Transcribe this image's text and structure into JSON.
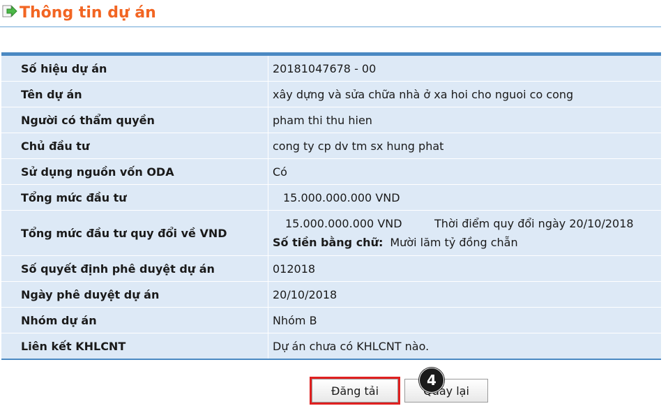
{
  "header": {
    "title": "Thông tin dự án",
    "icon": "export-arrow-icon",
    "title_color": "#f26522"
  },
  "rows": [
    {
      "label": "Số hiệu dự án",
      "value": "20181047678  -  00"
    },
    {
      "label": "Tên dự án",
      "value": "xây dựng và sửa chữa nhà ở xa hoi cho nguoi co cong"
    },
    {
      "label": "Người có thẩm quyền",
      "value": "pham thi thu hien"
    },
    {
      "label": "Chủ đầu tư",
      "value": "cong ty cp dv tm sx hung phat"
    },
    {
      "label": "Sử dụng nguồn vốn ODA",
      "value": "Có"
    },
    {
      "label": "Tổng mức đầu tư",
      "value": "15.000.000.000 VND"
    },
    {
      "label": "Tổng mức đầu tư quy đổi về VND",
      "amount": "15.000.000.000 VND",
      "conversion_note": "Thời điểm quy đổi ngày 20/10/2018",
      "words_label": "Số tiền bằng chữ:",
      "words_value": "Mười lăm tỷ đồng chẵn"
    },
    {
      "label": "Số quyết định phê duyệt dự án",
      "value": "012018"
    },
    {
      "label": "Ngày phê duyệt dự án",
      "value": "20/10/2018"
    },
    {
      "label": "Nhóm dự án",
      "value": "Nhóm B"
    },
    {
      "label": "Liên kết KHLCNT",
      "value": "Dự án chưa có KHLCNT nào."
    }
  ],
  "buttons": {
    "upload_label": "Đăng tải",
    "back_label": "Quay lại"
  },
  "step_badge": "4",
  "colors": {
    "table_bg": "#dde9f6",
    "table_border": "#4a89c2",
    "highlight": "#e02020"
  }
}
